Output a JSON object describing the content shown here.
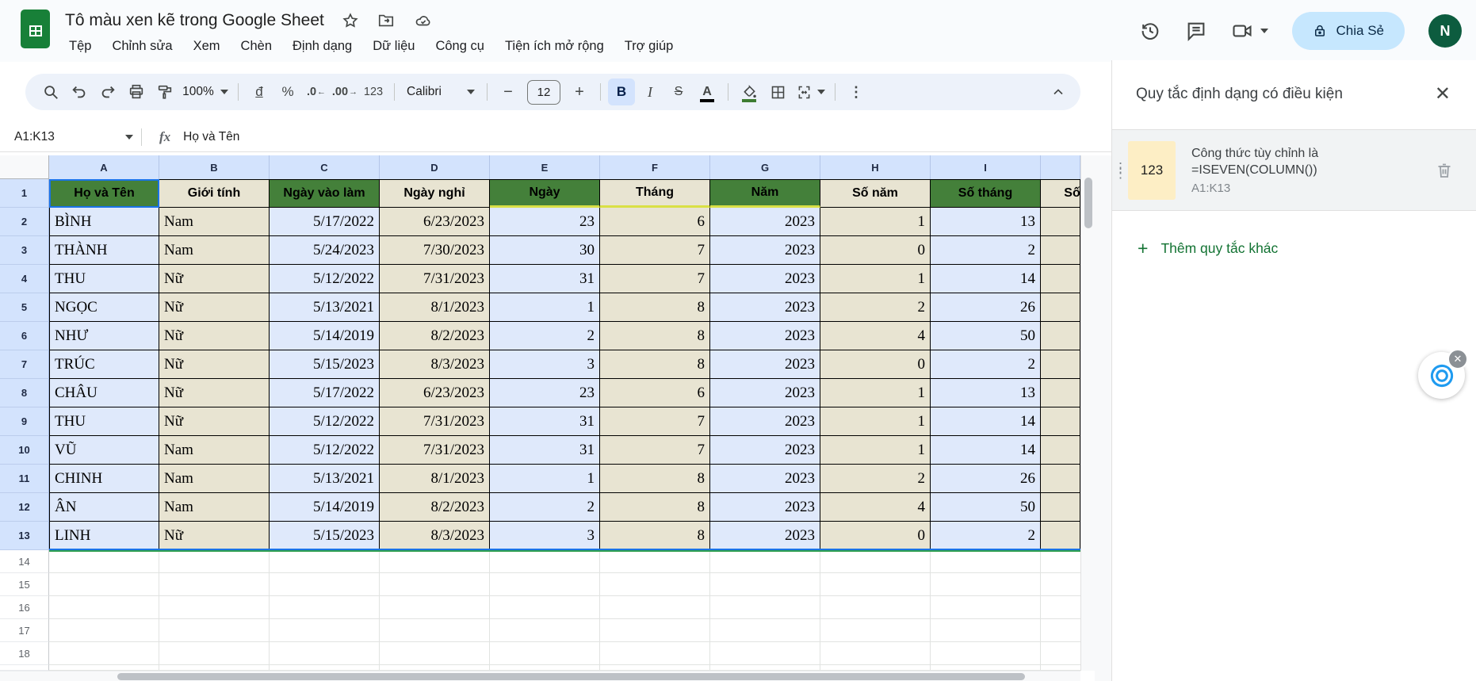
{
  "header": {
    "doc_title": "Tô màu xen kẽ trong Google Sheet",
    "menus": [
      "Tệp",
      "Chỉnh sửa",
      "Xem",
      "Chèn",
      "Định dạng",
      "Dữ liệu",
      "Công cụ",
      "Tiện ích mở rộng",
      "Trợ giúp"
    ],
    "share_label": "Chia Sẻ",
    "avatar_initial": "N"
  },
  "toolbar": {
    "zoom": "100%",
    "currency": "đ",
    "percent": "%",
    "decrease_decimal": ".0",
    "increase_decimal": ".00",
    "number_format": "123",
    "font_name": "Calibri",
    "font_size": "12",
    "bold": "B",
    "italic": "I",
    "strikethrough": "S",
    "text_color": "A"
  },
  "formula_bar": {
    "name_box": "A1:K13",
    "fx": "fx",
    "value": "Họ và Tên"
  },
  "sheet": {
    "column_letters": [
      "A",
      "B",
      "C",
      "D",
      "E",
      "F",
      "G",
      "H",
      "I"
    ],
    "clipped_column_header_text": "Số",
    "header_row": [
      "Họ và Tên",
      "Giới tính",
      "Ngày vào làm",
      "Ngày nghỉ",
      "Ngày",
      "Tháng",
      "Năm",
      "Số năm",
      "Số tháng"
    ],
    "rows": [
      [
        "BÌNH",
        "Nam",
        "5/17/2022",
        "6/23/2023",
        "23",
        "6",
        "2023",
        "1",
        "13"
      ],
      [
        "THÀNH",
        "Nam",
        "5/24/2023",
        "7/30/2023",
        "30",
        "7",
        "2023",
        "0",
        "2"
      ],
      [
        "THU",
        "Nữ",
        "5/12/2022",
        "7/31/2023",
        "31",
        "7",
        "2023",
        "1",
        "14"
      ],
      [
        "NGỌC",
        "Nữ",
        "5/13/2021",
        "8/1/2023",
        "1",
        "8",
        "2023",
        "2",
        "26"
      ],
      [
        "NHƯ",
        "Nữ",
        "5/14/2019",
        "8/2/2023",
        "2",
        "8",
        "2023",
        "4",
        "50"
      ],
      [
        "TRÚC",
        "Nữ",
        "5/15/2023",
        "8/3/2023",
        "3",
        "8",
        "2023",
        "0",
        "2"
      ],
      [
        "CHÂU",
        "Nữ",
        "5/17/2022",
        "6/23/2023",
        "23",
        "6",
        "2023",
        "1",
        "13"
      ],
      [
        "THU",
        "Nữ",
        "5/12/2022",
        "7/31/2023",
        "31",
        "7",
        "2023",
        "1",
        "14"
      ],
      [
        "VŨ",
        "Nam",
        "5/12/2022",
        "7/31/2023",
        "31",
        "7",
        "2023",
        "1",
        "14"
      ],
      [
        "CHINH",
        "Nam",
        "5/13/2021",
        "8/1/2023",
        "1",
        "8",
        "2023",
        "2",
        "26"
      ],
      [
        "ÂN",
        "Nam",
        "5/14/2019",
        "8/2/2023",
        "2",
        "8",
        "2023",
        "4",
        "50"
      ],
      [
        "LINH",
        "Nữ",
        "5/15/2023",
        "8/3/2023",
        "3",
        "8",
        "2023",
        "0",
        "2"
      ]
    ],
    "empty_row_numbers": [
      "14",
      "15",
      "16",
      "17",
      "18"
    ]
  },
  "panel": {
    "title": "Quy tắc định dạng có điều kiện",
    "close": "✕",
    "rule": {
      "preview": "123",
      "condition_line1": "Công thức tùy chỉnh là",
      "condition_line2": "=ISEVEN(COLUMN())",
      "range": "A1:K13"
    },
    "add_rule_label": "Thêm quy tắc khác",
    "add_rule_plus": "+"
  },
  "colors": {
    "green": "#44803a",
    "beige": "#e8e4d2",
    "selblue": "#dfe9fb",
    "headblue": "#d3e3fd",
    "accent": "#1a73e8",
    "yellowline": "#d9e045",
    "addgreen": "#137333",
    "swatch": "#fdeec5"
  }
}
